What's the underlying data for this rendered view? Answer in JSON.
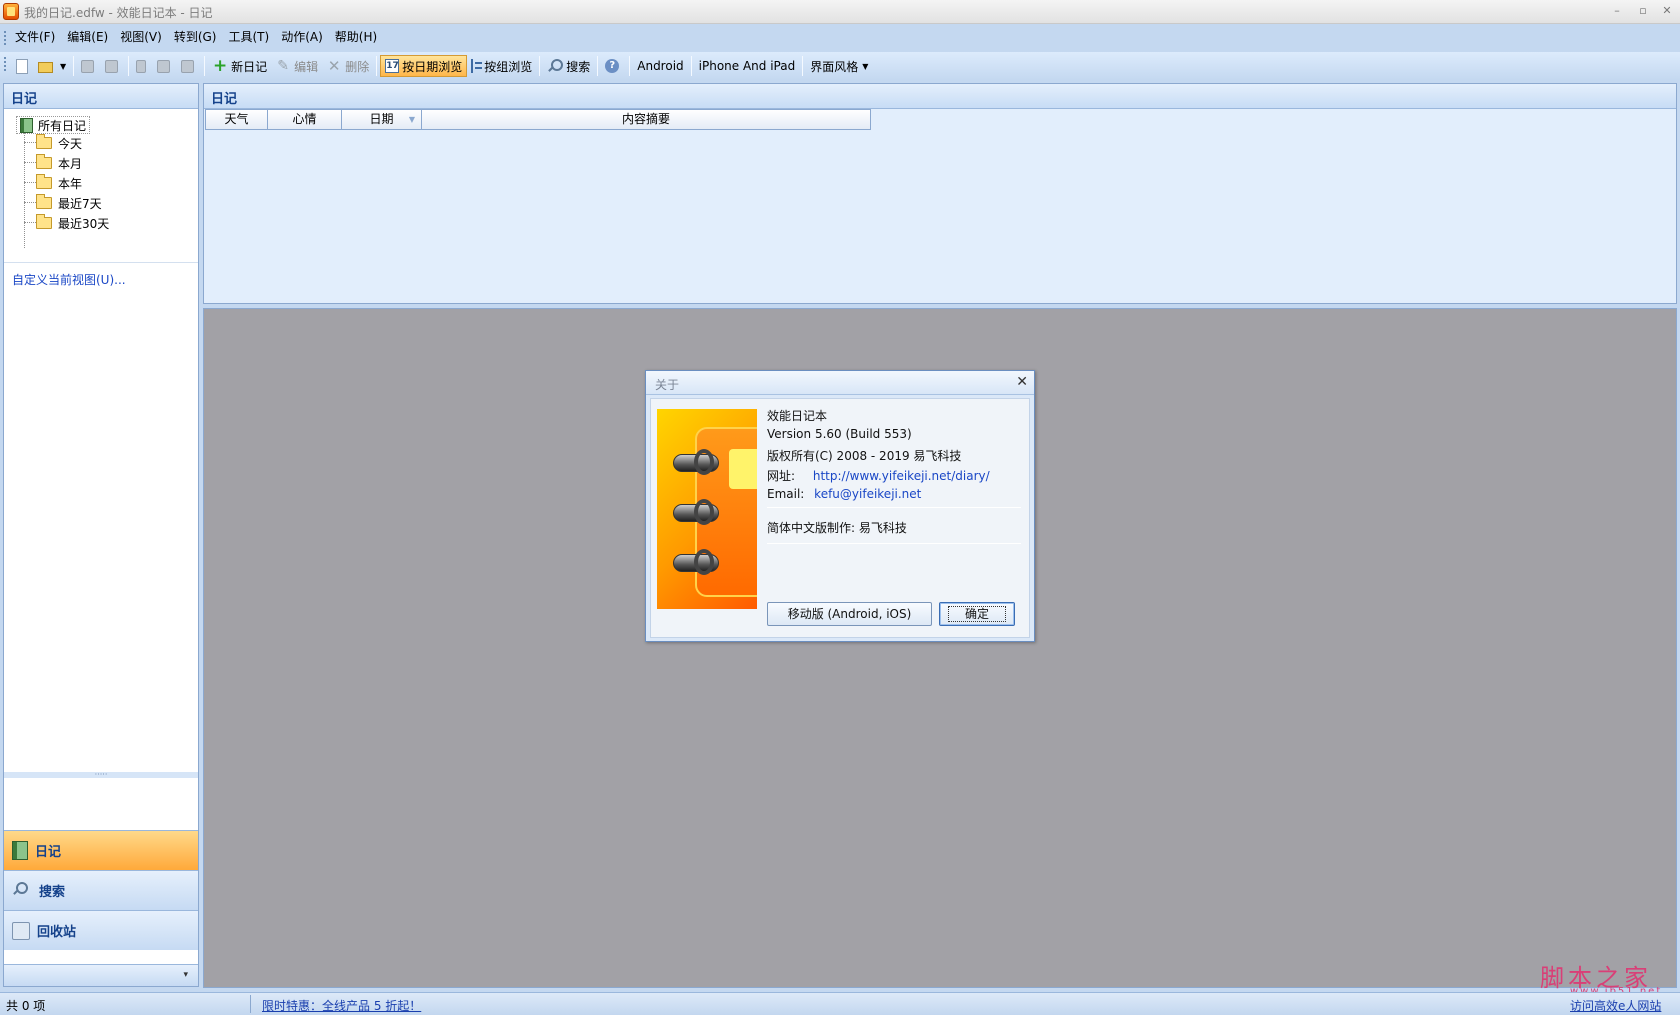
{
  "window": {
    "title": "我的日记.edfw - 效能日记本 - 日记",
    "minimize_glyph": "–",
    "maximize_glyph": "▫",
    "close_glyph": "✕"
  },
  "menu": {
    "items": [
      "文件(F)",
      "编辑(E)",
      "视图(V)",
      "转到(G)",
      "工具(T)",
      "动作(A)",
      "帮助(H)"
    ]
  },
  "toolbar": {
    "new_diary": "新日记",
    "edit": "编辑",
    "delete": "删除",
    "browse_by_date": "按日期浏览",
    "browse_by_group": "按组浏览",
    "search": "搜索",
    "android": "Android",
    "iphone_ipad": "iPhone And iPad",
    "ui_style": "界面风格",
    "calendar_glyph": "17",
    "help_glyph": "?"
  },
  "left_pane": {
    "header": "日记",
    "tree": {
      "root": "所有日记",
      "children": [
        "今天",
        "本月",
        "本年",
        "最近7天",
        "最近30天"
      ]
    },
    "customize_link": "自定义当前视图(U)...",
    "grip": "·····",
    "nav_buttons": [
      "日记",
      "搜索",
      "回收站"
    ],
    "footer_arrow": "▾"
  },
  "list_pane": {
    "header": "日记",
    "columns": [
      "天气",
      "心情",
      "日期",
      "内容摘要"
    ]
  },
  "about_dialog": {
    "title": "关于",
    "close_glyph": "✕",
    "product_name": "效能日记本",
    "version": "Version 5.60 (Build 553)",
    "copyright": "版权所有(C) 2008 - 2019 易飞科技",
    "website_label": "网址:",
    "website_url": "http://www.yifeikeji.net/diary/",
    "email_label": "Email:",
    "email": "kefu@yifeikeji.net",
    "localization": "简体中文版制作:  易飞科技",
    "mobile_button": "移动版 (Android, iOS)",
    "ok_button": "确定"
  },
  "watermark": {
    "main": "脚本之家",
    "url": "www.jb51.net"
  },
  "status_bar": {
    "count": "共 0 项",
    "promo": "限时特惠：全线产品 5 折起！",
    "visit": "访问高效e人网站"
  }
}
